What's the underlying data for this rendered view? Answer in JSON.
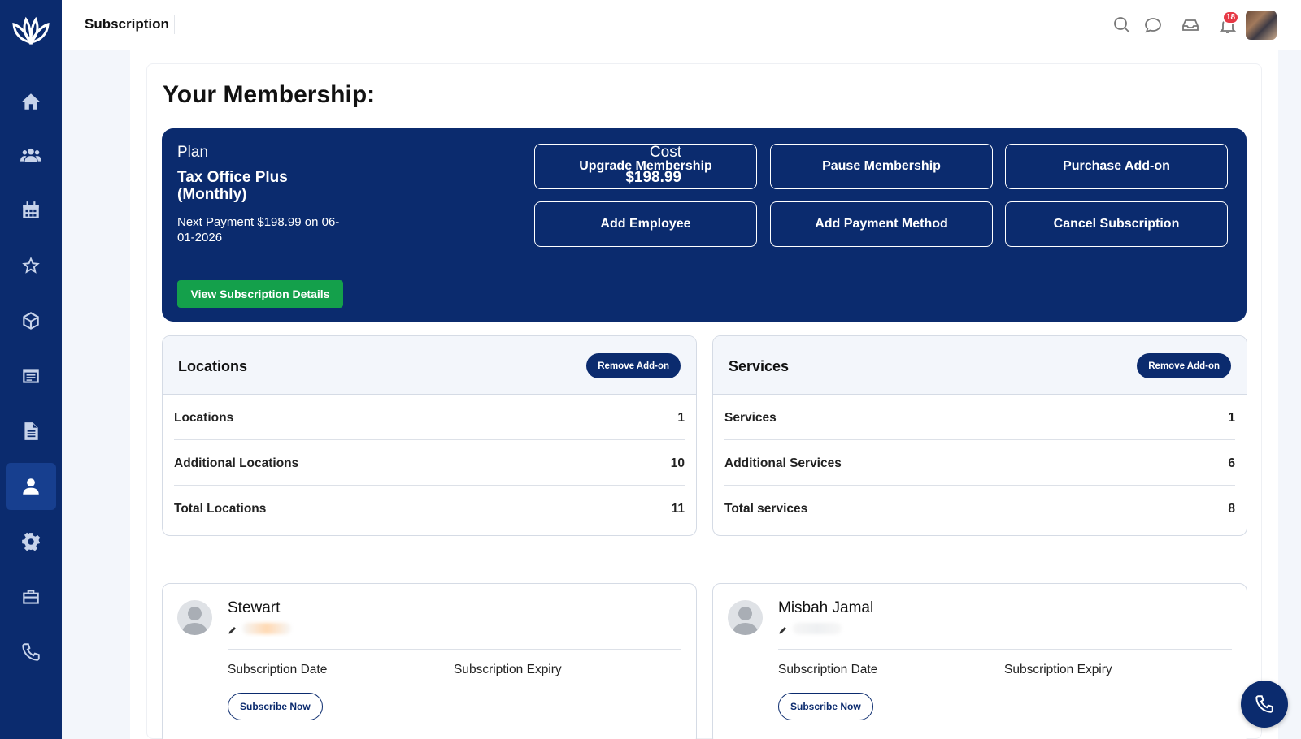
{
  "header": {
    "title": "Subscription",
    "notification_count": "18"
  },
  "sidebar": {
    "items": [
      {
        "icon": "home-icon"
      },
      {
        "icon": "users-icon"
      },
      {
        "icon": "calendar-icon"
      },
      {
        "icon": "star-icon"
      },
      {
        "icon": "cube-icon"
      },
      {
        "icon": "form-icon"
      },
      {
        "icon": "document-icon"
      },
      {
        "icon": "user-icon",
        "active": true
      },
      {
        "icon": "gear-icon"
      },
      {
        "icon": "briefcase-icon"
      },
      {
        "icon": "phone-icon"
      }
    ]
  },
  "page": {
    "heading": "Your Membership:"
  },
  "plan": {
    "plan_label": "Plan",
    "plan_name": "Tax Office Plus (Monthly)",
    "next_payment": "Next Payment $198.99 on 06-01-2026",
    "cost_label": "Cost",
    "cost": "$198.99",
    "buttons": {
      "upgrade": "Upgrade Membership",
      "pause": "Pause Membership",
      "purchase_addon": "Purchase Add-on",
      "add_employee": "Add Employee",
      "add_payment": "Add Payment Method",
      "cancel": "Cancel Subscription"
    },
    "view_details": "View Subscription Details"
  },
  "locations": {
    "title": "Locations",
    "remove_label": "Remove Add-on",
    "rows": [
      {
        "label": "Locations",
        "value": "1"
      },
      {
        "label": "Additional Locations",
        "value": "10"
      },
      {
        "label": "Total Locations",
        "value": "11"
      }
    ]
  },
  "services": {
    "title": "Services",
    "remove_label": "Remove Add-on",
    "rows": [
      {
        "label": "Services",
        "value": "1"
      },
      {
        "label": "Additional Services",
        "value": "6"
      },
      {
        "label": "Total services",
        "value": "8"
      }
    ]
  },
  "employees": [
    {
      "name": "Stewart",
      "date_label": "Subscription Date",
      "expiry_label": "Subscription Expiry",
      "button": "Subscribe Now"
    },
    {
      "name": "Misbah Jamal",
      "date_label": "Subscription Date",
      "expiry_label": "Subscription Expiry",
      "button": "Subscribe Now"
    }
  ],
  "colors": {
    "brand_navy": "#0b2b6e",
    "success_green": "#14a04b",
    "badge_red": "#e63946"
  }
}
